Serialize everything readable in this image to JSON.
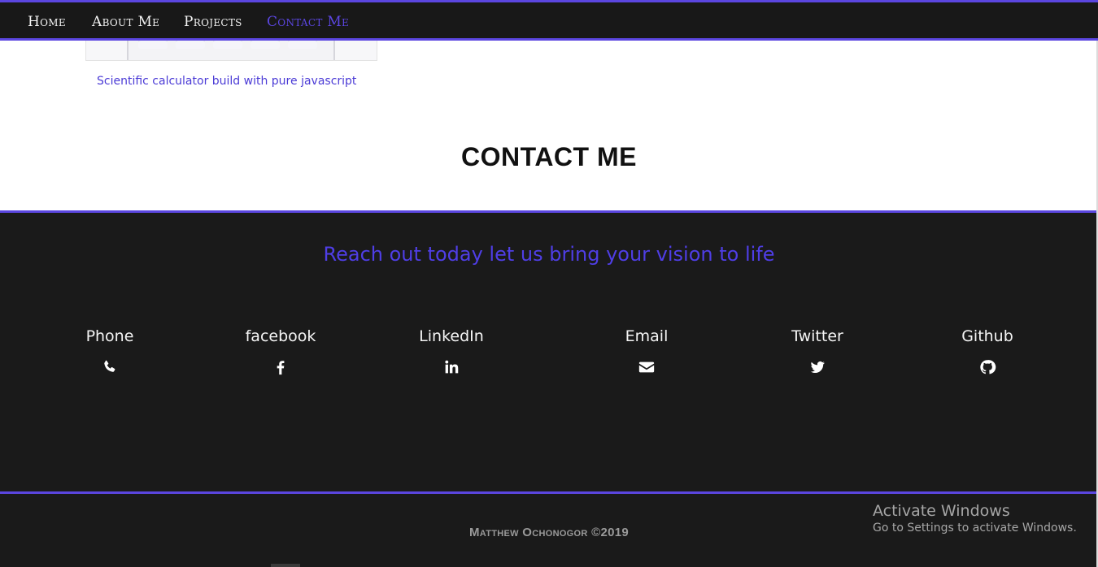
{
  "nav": {
    "items": [
      {
        "label": "Home",
        "active": false
      },
      {
        "label": "About Me",
        "active": false
      },
      {
        "label": "Projects",
        "active": false
      },
      {
        "label": "Contact Me",
        "active": true
      }
    ]
  },
  "project": {
    "caption": "Scientific calculator build with pure javascript"
  },
  "contact_section": {
    "heading": "CONTACT ME",
    "tagline": "Reach out today let us bring your vision to life",
    "items": [
      {
        "label": "Phone",
        "icon": "phone-icon"
      },
      {
        "label": "facebook",
        "icon": "facebook-icon"
      },
      {
        "label": "LinkedIn",
        "icon": "linkedin-icon"
      },
      {
        "label": "Email",
        "icon": "envelope-icon"
      },
      {
        "label": "Twitter",
        "icon": "twitter-icon"
      },
      {
        "label": "Github",
        "icon": "github-icon"
      }
    ]
  },
  "footer": {
    "copyright": "Matthew Ochonogor ©2019"
  },
  "os_overlay": {
    "title": "Activate Windows",
    "subtitle": "Go to Settings to activate Windows."
  },
  "colors": {
    "accent": "#5b46e0",
    "dark_bg": "#1a1a1a",
    "nav_text": "#f2f2f2"
  }
}
